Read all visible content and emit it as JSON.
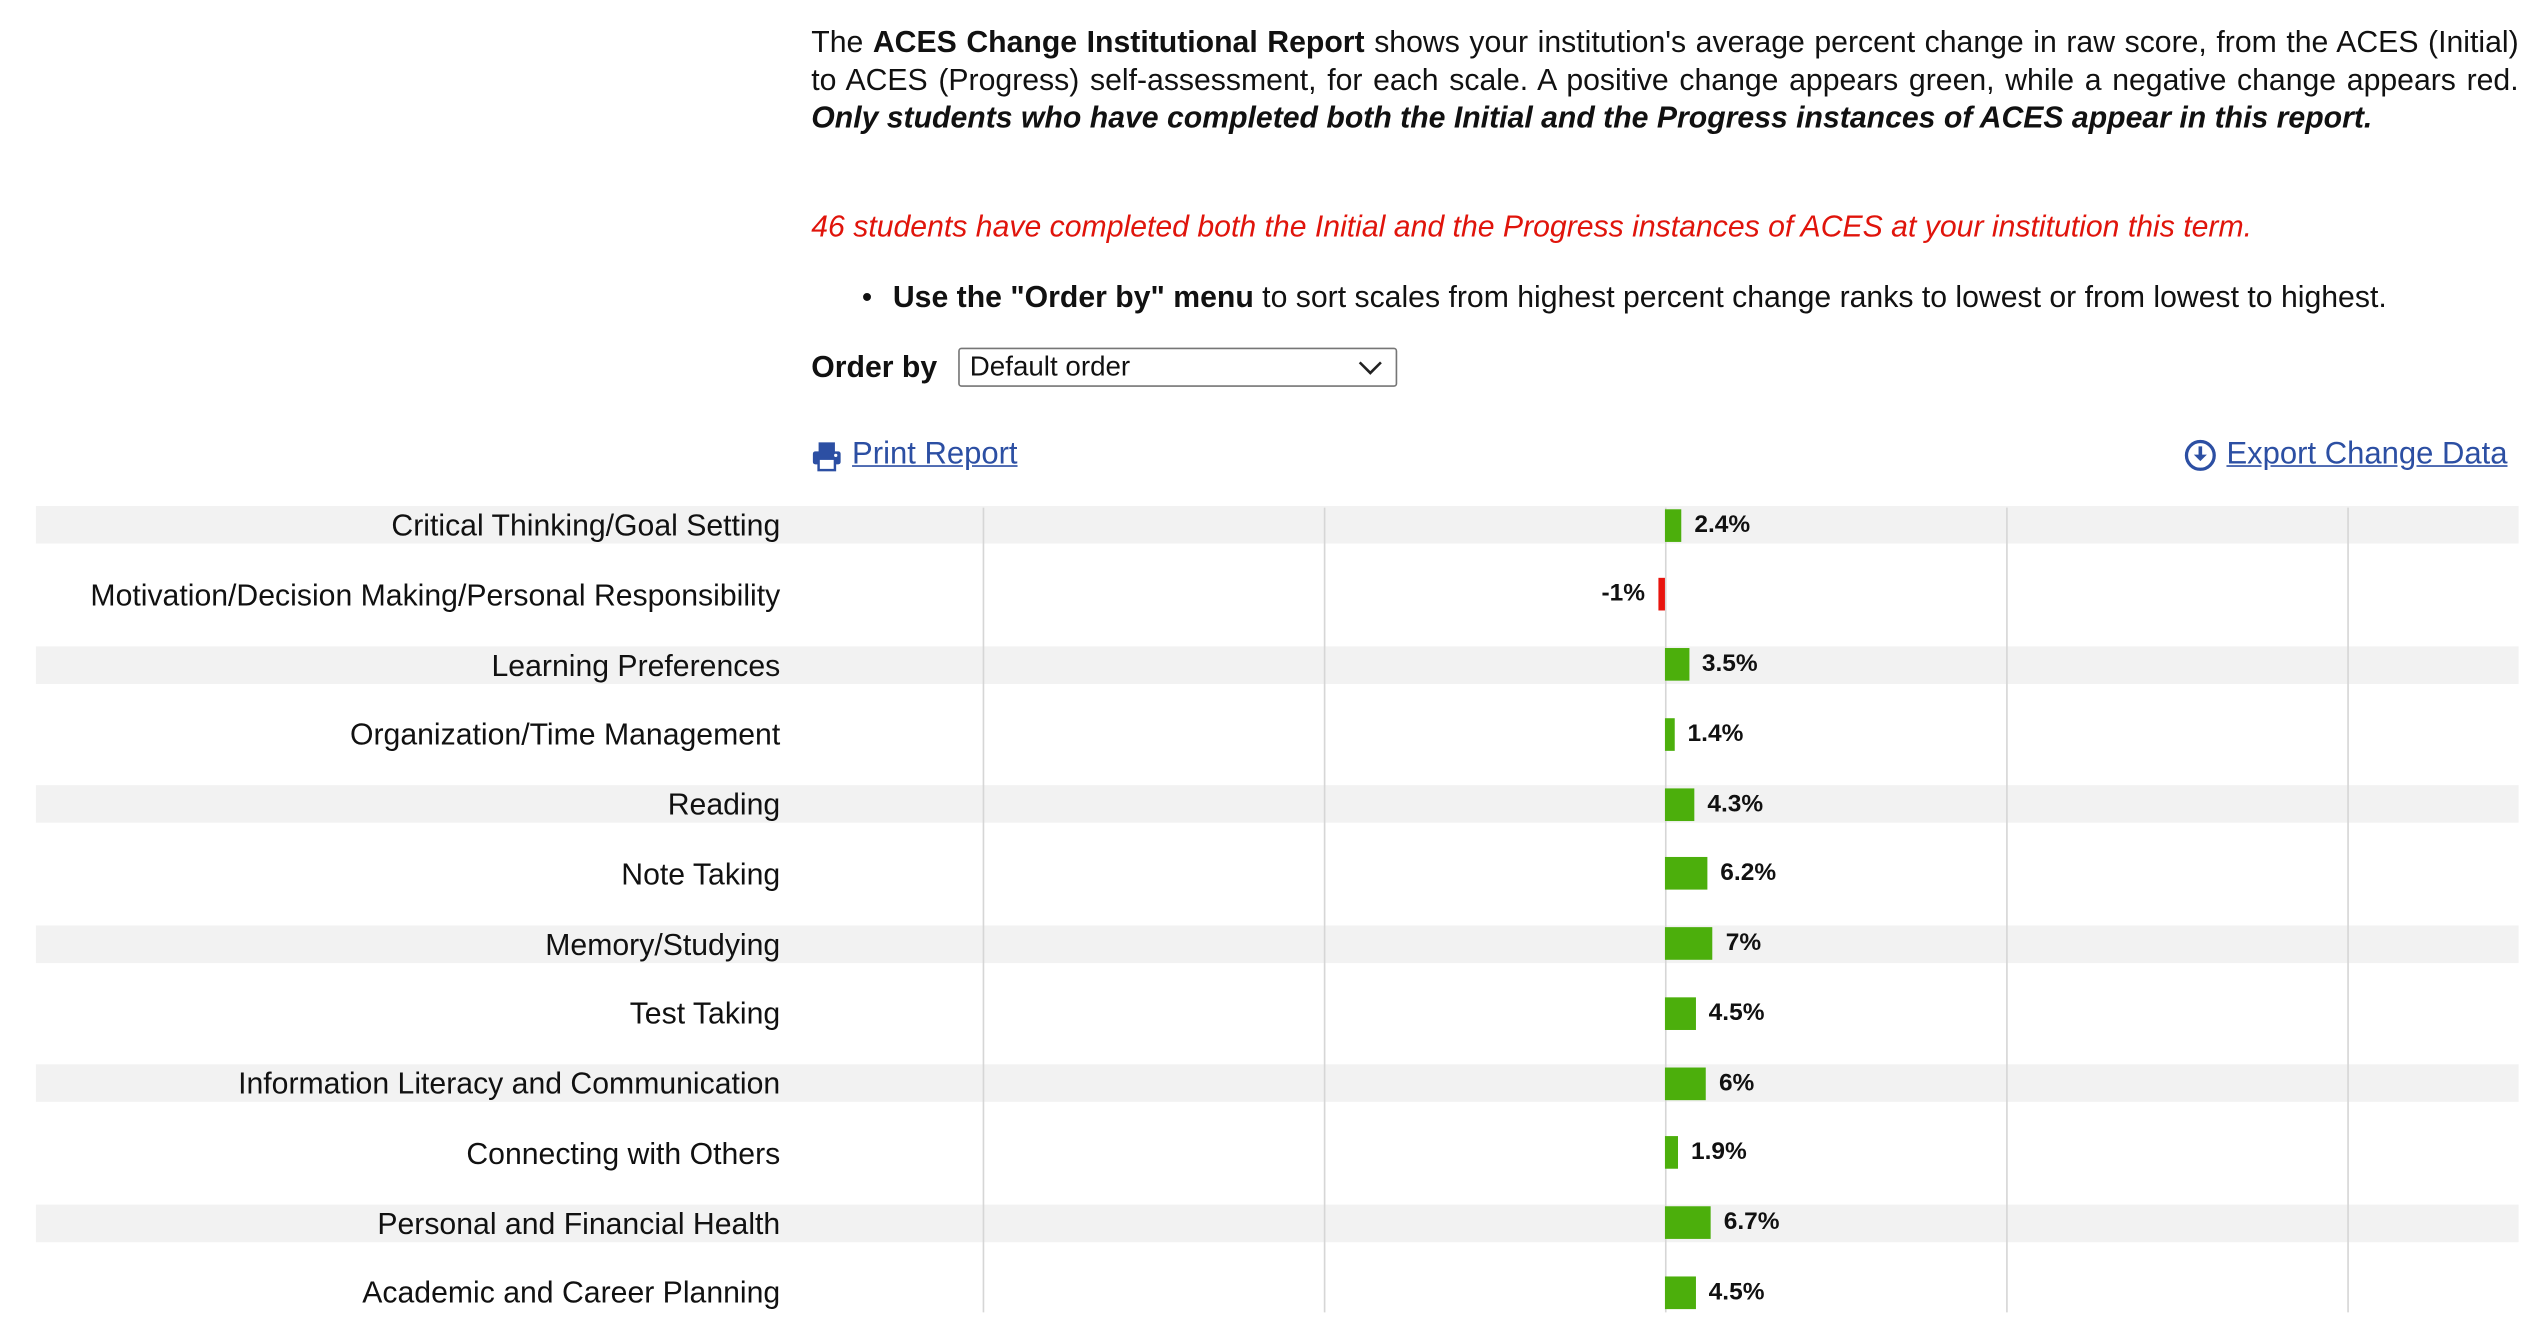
{
  "intro": {
    "pre": "The ",
    "report_name": "ACES Change Institutional Report",
    "body": " shows your institution's average percent change in raw score, from the ACES (Initial) to ACES (Progress) self-assessment, for each scale. A positive change appears green, while a negative change appears red. ",
    "emphasis": "Only students who have completed both the Initial and the Progress instances of ACES appear in this report."
  },
  "notice": "46 students have completed both the Initial and the Progress instances of ACES at your institution this term.",
  "tip": {
    "bold": "Use the \"Order by\" menu",
    "rest": " to sort scales from highest percent change ranks to lowest or from lowest to highest."
  },
  "order_by": {
    "label": "Order by",
    "selected": "Default order"
  },
  "links": {
    "print": "Print Report",
    "export": "Export Change Data"
  },
  "icons": {
    "print": "printer-icon",
    "export": "download-circle-icon",
    "dropdown": "chevron-down-icon"
  },
  "colors": {
    "positive": "#4caf0c",
    "negative": "#e8140e",
    "link": "#2c4fa3",
    "notice": "#e0140b",
    "band": "#f2f2f2"
  },
  "chart_data": {
    "type": "bar",
    "orientation": "horizontal",
    "categories": [
      "Critical Thinking/Goal Setting",
      "Motivation/Decision Making/Personal Responsibility",
      "Learning Preferences",
      "Organization/Time Management",
      "Reading",
      "Note Taking",
      "Memory/Studying",
      "Test Taking",
      "Information Literacy and Communication",
      "Connecting with Others",
      "Personal and Financial Health",
      "Academic and Career Planning"
    ],
    "values": [
      2.4,
      -1,
      3.5,
      1.4,
      4.3,
      6.2,
      7,
      4.5,
      6,
      1.9,
      6.7,
      4.5
    ],
    "value_labels": [
      "2.4%",
      "-1%",
      "3.5%",
      "1.4%",
      "4.3%",
      "6.2%",
      "7%",
      "4.5%",
      "6%",
      "1.9%",
      "6.7%",
      "4.5%"
    ],
    "xlim": [
      -100,
      125
    ],
    "grid": true,
    "legend": "none"
  }
}
